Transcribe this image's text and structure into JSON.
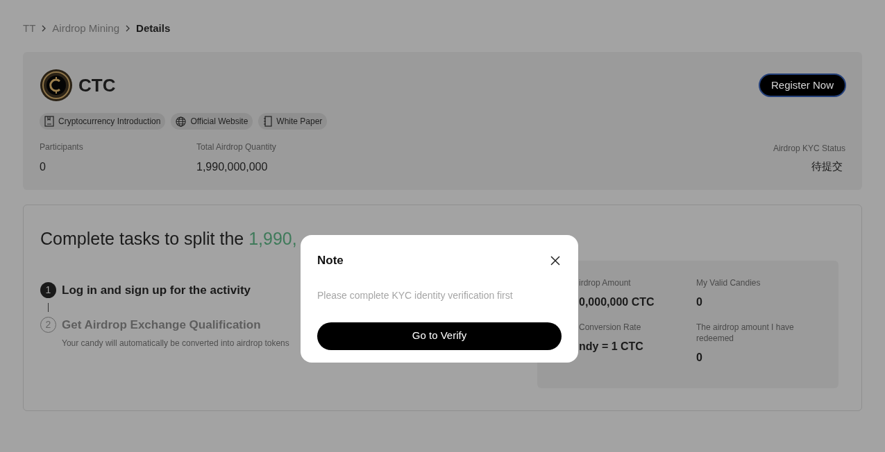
{
  "breadcrumb": [
    {
      "label": "TT",
      "current": false
    },
    {
      "label": "Airdrop Mining",
      "current": false
    },
    {
      "label": "Details",
      "current": true
    }
  ],
  "token": {
    "name": "CTC",
    "register_button": "Register Now",
    "links": [
      {
        "kind": "document",
        "label": "Cryptocurrency Introduction"
      },
      {
        "kind": "globe",
        "label": "Official Website"
      },
      {
        "kind": "notebook",
        "label": "White Paper"
      }
    ],
    "stats": [
      {
        "label": "Participants",
        "value": "0"
      },
      {
        "label": "Total Airdrop Quantity",
        "value": "1,990,000,000"
      }
    ],
    "kyc": {
      "label": "Airdrop KYC Status",
      "value": "待提交"
    }
  },
  "tasks": {
    "heading": "Complete tasks to split the ",
    "heading_highlight": "1,990,",
    "steps": [
      {
        "number": "1",
        "title": "Log in and sign up for the activity",
        "active": true
      },
      {
        "number": "2",
        "title": "Get Airdrop Exchange Qualification",
        "description": "Your candy will automatically be converted into airdrop tokens",
        "active": false
      }
    ],
    "panel": [
      {
        "label": "irdrop Amount",
        "value": "0,000,000 CTC"
      },
      {
        "label": "My Valid Candies",
        "value": "0"
      },
      {
        "label": "Conversion Rate",
        "value": "ndy = 1 CTC"
      },
      {
        "label": "The airdrop amount I have redeemed",
        "value": "0"
      }
    ]
  },
  "modal": {
    "title": "Note",
    "message": "Please complete KYC identity verification first",
    "button": "Go to Verify"
  }
}
